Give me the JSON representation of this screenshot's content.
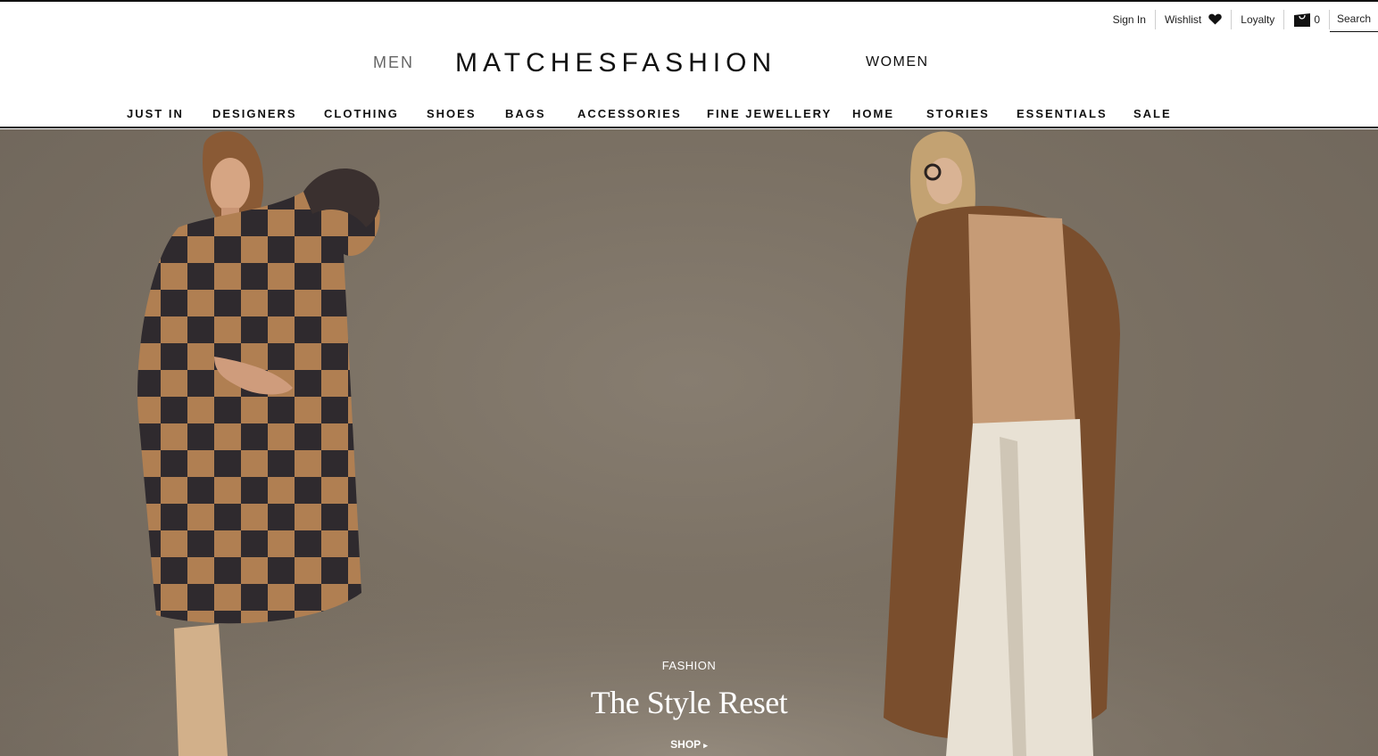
{
  "utility": {
    "sign_in": "Sign In",
    "wishlist": "Wishlist",
    "loyalty": "Loyalty",
    "bag_count": "0",
    "search": "Search",
    "icons": [
      "heart-icon",
      "shopping-bag-icon"
    ]
  },
  "header": {
    "men": "MEN",
    "logo": "MATCHESFASHION",
    "women": "WOMEN"
  },
  "nav": {
    "items": [
      "JUST IN",
      "DESIGNERS",
      "CLOTHING",
      "SHOES",
      "BAGS",
      "ACCESSORIES",
      "FINE JEWELLERY",
      "HOME",
      "STORIES",
      "ESSENTIALS",
      "SALE"
    ]
  },
  "hero": {
    "kicker": "FASHION",
    "title": "The Style Reset",
    "cta": "SHOP",
    "cta_icon": "caret-right-icon"
  },
  "colors": {
    "text": "#111111",
    "muted": "#666666",
    "hero_background": "#7a7063"
  }
}
